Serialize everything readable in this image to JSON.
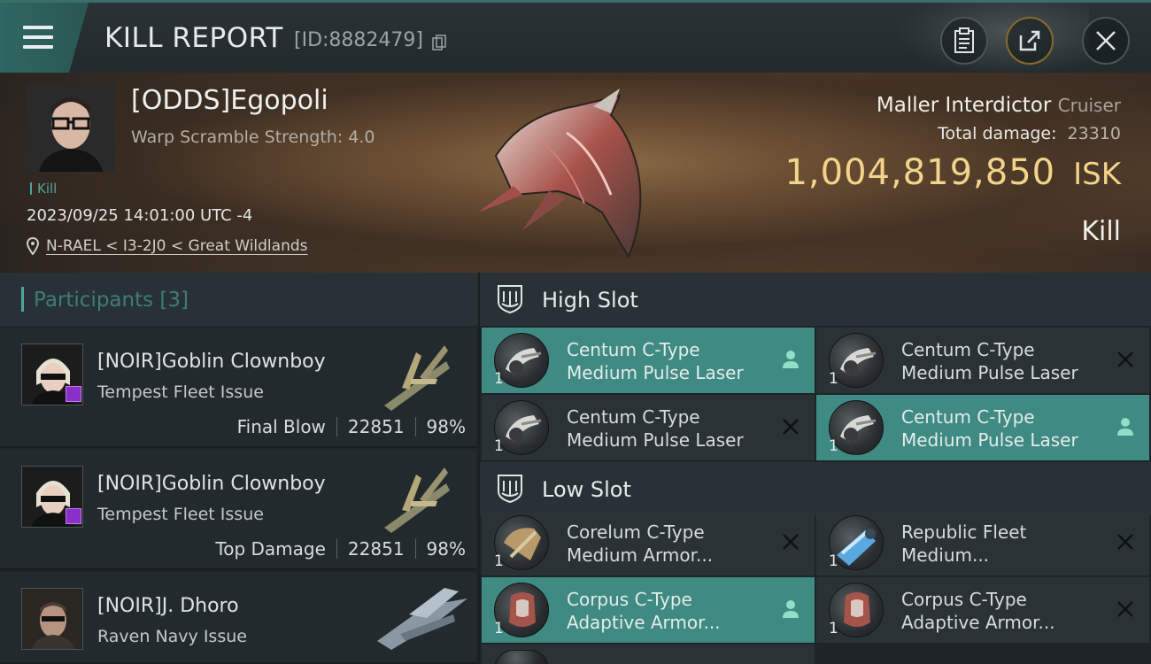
{
  "header": {
    "title": "KILL REPORT",
    "report_id": "[ID:8882479]",
    "buttons": {
      "clipboard": "clipboard-icon",
      "share": "share-icon",
      "close": "close-icon"
    }
  },
  "victim": {
    "name": "[ODDS]Egopoli",
    "subtitle": "Warp Scramble Strength: 4.0",
    "tag": "Kill",
    "datetime": "2023/09/25 14:01:00 UTC -4",
    "location": "N-RAEL < I3-2J0 < Great Wildlands",
    "ship_name": "Maller Interdictor",
    "ship_class": "Cruiser",
    "damage_label": "Total damage:",
    "damage_value": "23310",
    "isk_value": "1,004,819,850",
    "isk_unit": "ISK",
    "result": "Kill"
  },
  "participants": {
    "title": "Participants",
    "count": "[3]",
    "rows": [
      {
        "name": "[NOIR]Goblin Clownboy",
        "ship": "Tempest Fleet Issue",
        "role": "Final Blow",
        "damage": "22851",
        "percent": "98%"
      },
      {
        "name": "[NOIR]Goblin Clownboy",
        "ship": "Tempest Fleet Issue",
        "role": "Top Damage",
        "damage": "22851",
        "percent": "98%"
      },
      {
        "name": "[NOIR]J. Dhoro",
        "ship": "Raven Navy Issue",
        "role": "",
        "damage": "",
        "percent": ""
      }
    ]
  },
  "high_slot": {
    "title": "High Slot",
    "modules": [
      {
        "line1": "Centum C-Type",
        "line2": "Medium Pulse Laser",
        "qty": "1",
        "status": "dropped"
      },
      {
        "line1": "Centum C-Type",
        "line2": "Medium Pulse Laser",
        "qty": "1",
        "status": "destroyed"
      },
      {
        "line1": "Centum C-Type",
        "line2": "Medium Pulse Laser",
        "qty": "1",
        "status": "destroyed"
      },
      {
        "line1": "Centum C-Type",
        "line2": "Medium Pulse Laser",
        "qty": "1",
        "status": "dropped"
      }
    ]
  },
  "low_slot": {
    "title": "Low Slot",
    "modules": [
      {
        "line1": "Corelum C-Type",
        "line2": "Medium Armor...",
        "qty": "1",
        "status": "destroyed"
      },
      {
        "line1": "Republic Fleet",
        "line2": "Medium...",
        "qty": "1",
        "status": "destroyed"
      },
      {
        "line1": "Corpus C-Type",
        "line2": "Adaptive Armor...",
        "qty": "1",
        "status": "dropped"
      },
      {
        "line1": "Corpus C-Type",
        "line2": "Adaptive Armor...",
        "qty": "1",
        "status": "destroyed"
      }
    ]
  },
  "colors": {
    "accent": "#3f8a82",
    "isk": "#f2d48a",
    "teal_text": "#4fa59b"
  }
}
